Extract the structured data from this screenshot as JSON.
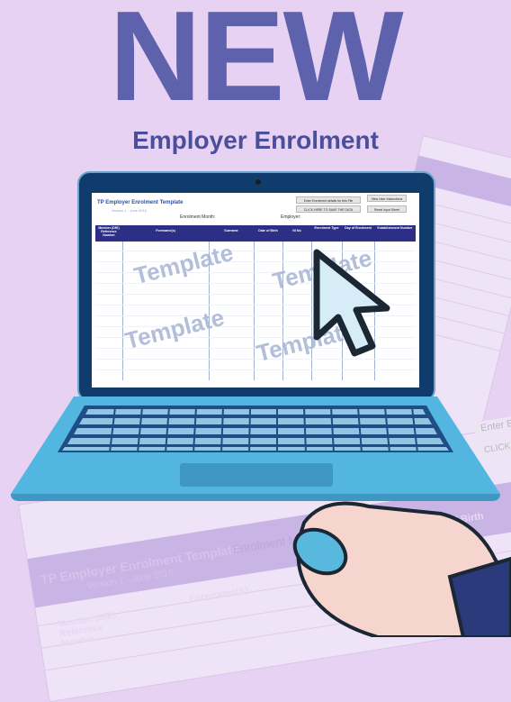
{
  "headline": "NEW",
  "subhead": "Employer Enrolment",
  "colors": {
    "headline": "#5e62ac",
    "background": "#e7d2f3",
    "laptop_body": "#4bb0da",
    "screen_frame": "#0f3b6d",
    "table_header": "#2d2f86"
  },
  "screen": {
    "title": "TP Employer Enrolment Template",
    "version": "Version 1 - June 2016",
    "enrolment_month_label": "Enrolment Month:",
    "employer_label": "Employer:",
    "buttons": {
      "enter_details": "Enter Enrolment details for this File",
      "save": "CLICK HERE TO SAVE THE DATA",
      "view_instructions": "View User Instructions",
      "reset": "Reset Input Sheet"
    },
    "columns": [
      "Member (DfE) Reference Number",
      "Forename(s)",
      "Surname",
      "Date of Birth",
      "NI No",
      "Enrolment Type",
      "Day of Enrolment",
      "Establishment Number"
    ],
    "watermark": "Template"
  },
  "background_sheet": {
    "title": "TP Employer Enrolment Template",
    "version": "Version 1 - June 2016",
    "enrolment_month_label": "Enrolment Mo",
    "columns": [
      "Member (DfE) Reference Number",
      "Forename(s)",
      "Date of Birth"
    ],
    "buttons": [
      "Enter Enr",
      "CLICK"
    ]
  },
  "icons": [
    "cursor-arrow-icon",
    "hand-icon",
    "mouse-icon",
    "camera-icon"
  ]
}
